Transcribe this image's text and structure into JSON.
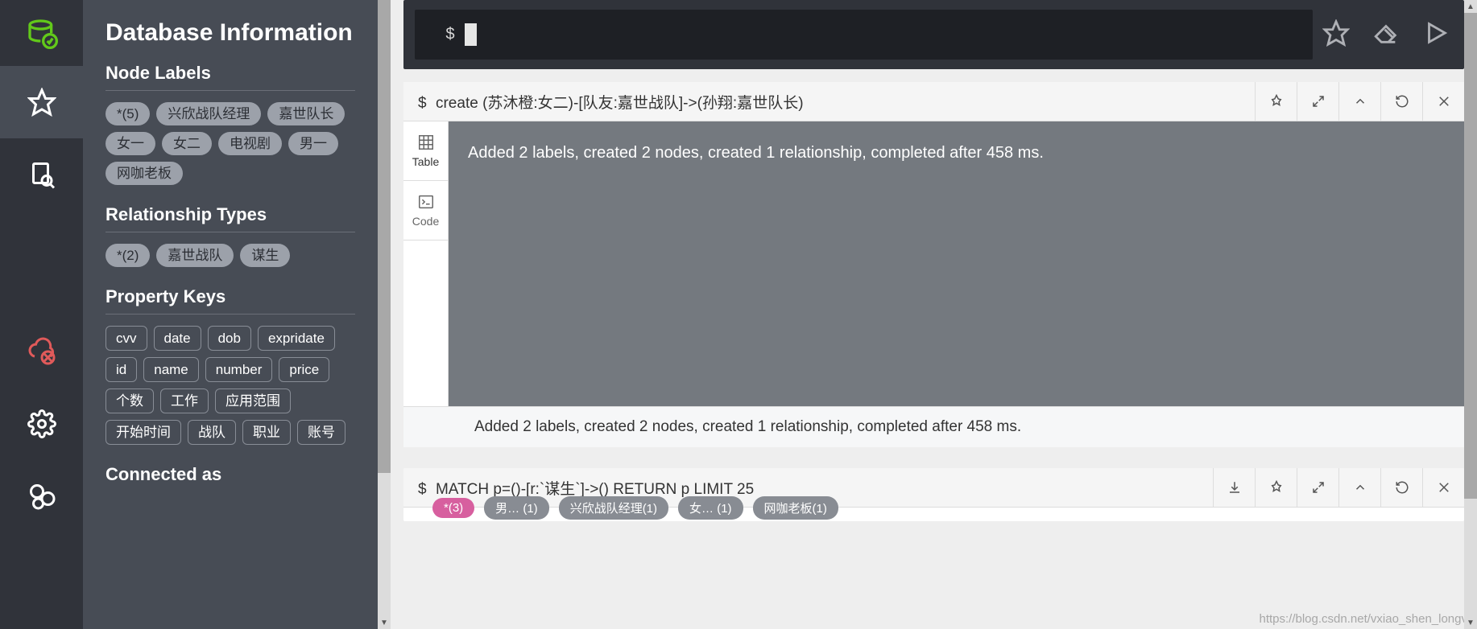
{
  "app": {
    "title": "Database Information"
  },
  "sections": {
    "node_labels_title": "Node Labels",
    "rel_types_title": "Relationship Types",
    "prop_keys_title": "Property Keys",
    "connected_title": "Connected as"
  },
  "node_labels": [
    "*(5)",
    "兴欣战队经理",
    "嘉世队长",
    "女一",
    "女二",
    "电视剧",
    "男一",
    "网咖老板"
  ],
  "rel_types": [
    "*(2)",
    "嘉世战队",
    "谋生"
  ],
  "prop_keys": [
    "cvv",
    "date",
    "dob",
    "expridate",
    "id",
    "name",
    "number",
    "price",
    "个数",
    "工作",
    "应用范围",
    "开始时间",
    "战队",
    "职业",
    "账号"
  ],
  "editor": {
    "prompt": "$",
    "value": ""
  },
  "frame1": {
    "cmd_prompt": "$",
    "cmd": "create (苏沐橙:女二)-[队友:嘉世战队]->(孙翔:嘉世队长)",
    "tabs": {
      "table": "Table",
      "code": "Code"
    },
    "result": "Added 2 labels, created 2 nodes, created 1 relationship, completed after 458 ms.",
    "status": "Added 2 labels, created 2 nodes, created 1 relationship, completed after 458 ms."
  },
  "frame2": {
    "cmd_prompt": "$",
    "cmd": "MATCH p=()-[r:`谋生`]->() RETURN p LIMIT 25",
    "bottom_pills": [
      "*(3)",
      "男… (1)",
      "兴欣战队经理(1)",
      "女… (1)",
      "网咖老板(1)"
    ]
  },
  "watermark": "https://blog.csdn.net/vxiao_shen_longv"
}
